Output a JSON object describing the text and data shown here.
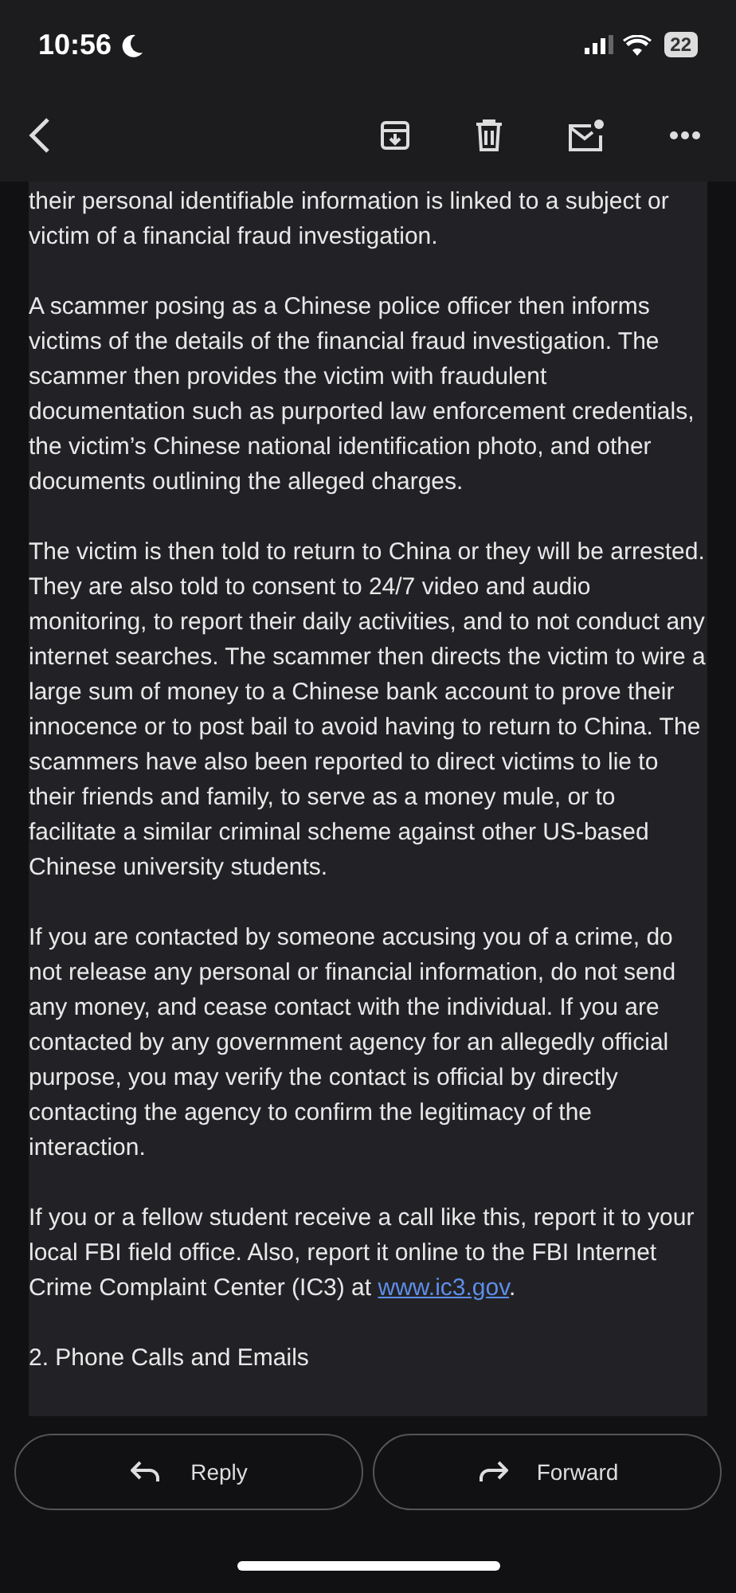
{
  "status_bar": {
    "time": "10:56",
    "battery": "22"
  },
  "body": [
    {
      "text": "their personal identifiable information is linked to a subject or victim of a financial fraud investigation."
    },
    {
      "text": "A scammer posing as a Chinese police officer then informs victims of the details of the financial fraud investigation. The scammer then provides the victim with fraudulent documentation such as purported law enforcement credentials, the victim’s Chinese national identification photo, and other documents outlining the alleged charges."
    },
    {
      "text": "The victim is then told to return to China or they will be arrested. They are also told to consent to 24/7 video and audio monitoring, to report their daily activities, and to not conduct any internet searches. The scammer then directs the victim to wire a large sum of money to a Chinese bank account to prove their innocence or to post bail to avoid having to return to China. The scammers have also been reported to direct victims to lie to their friends and family, to serve as a money mule, or to facilitate a similar criminal scheme against other US-based Chinese university students."
    },
    {
      "text": "If you are contacted by someone accusing you of a crime, do not release any personal or financial information, do not send any money, and cease contact with the individual. If you are contacted by any government agency for an allegedly official purpose, you may verify the contact is official by directly contacting the agency to confirm the legitimacy of the interaction."
    },
    {
      "text": "If you or a fellow student receive a call like this, report it to your local FBI field office. Also, report it online to the FBI Internet Crime Complaint Center (IC3) at ",
      "link": "www.ic3.gov",
      "after": "."
    },
    {
      "text": "2. Phone Calls and Emails"
    }
  ],
  "actions": [
    {
      "kind": "reply",
      "label": "Reply"
    },
    {
      "kind": "forward",
      "label": "Forward"
    }
  ]
}
